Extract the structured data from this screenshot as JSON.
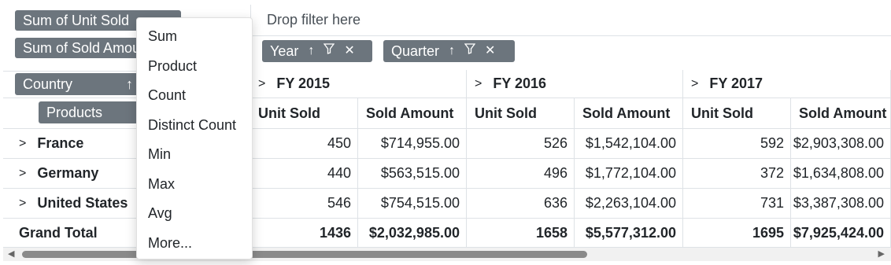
{
  "values_area": {
    "items": [
      "Sum of Unit Sold",
      "Sum of Sold Amount"
    ]
  },
  "filter_area": {
    "placeholder": "Drop filter here"
  },
  "columns_area": {
    "items": [
      "Year",
      "Quarter"
    ]
  },
  "rows_area": {
    "items": [
      "Country",
      "Products"
    ]
  },
  "years": [
    "FY 2015",
    "FY 2016",
    "FY 2017"
  ],
  "measures": {
    "unit_sold": "Unit Sold",
    "sold_amount": "Sold Amount"
  },
  "rows": [
    {
      "label": "France",
      "values": [
        "450",
        "$714,955.00",
        "526",
        "$1,542,104.00",
        "592",
        "$2,903,308.00"
      ]
    },
    {
      "label": "Germany",
      "values": [
        "440",
        "$563,515.00",
        "496",
        "$1,772,104.00",
        "372",
        "$1,634,808.00"
      ]
    },
    {
      "label": "United States",
      "values": [
        "546",
        "$754,515.00",
        "636",
        "$2,263,104.00",
        "731",
        "$3,387,308.00"
      ]
    }
  ],
  "grand_total": {
    "label": "Grand Total",
    "values": [
      "1436",
      "$2,032,985.00",
      "1658",
      "$5,577,312.00",
      "1695",
      "$7,925,424.00"
    ]
  },
  "menu": {
    "items": [
      "Sum",
      "Product",
      "Count",
      "Distinct Count",
      "Min",
      "Max",
      "Avg",
      "More..."
    ]
  },
  "icons": {
    "sort": "arrow-up-icon",
    "filter": "filter-icon",
    "remove": "close-icon",
    "expand": "chevron-right-icon"
  },
  "colors": {
    "pill_bg": "#6c757d",
    "border": "#dee2e6"
  }
}
